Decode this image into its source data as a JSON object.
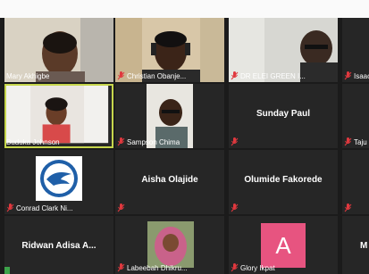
{
  "participants": [
    {
      "name": "Mary Akhigbe"
    },
    {
      "name": "Christian Obanje..."
    },
    {
      "name": "DR ELEI GREEN I..."
    },
    {
      "name": "Isaac"
    },
    {
      "name": "Buduka Johnson"
    },
    {
      "name": "Sampson Chima"
    },
    {
      "name": "Sunday Paul"
    },
    {
      "name": "Taju"
    },
    {
      "name": "Conrad Clark Ni..."
    },
    {
      "name": "Aisha Olajide"
    },
    {
      "name": "Olumide Fakorede"
    },
    {
      "name": ""
    },
    {
      "name": "Ridwan Adisa A..."
    },
    {
      "name": "Labeebah Dhikru..."
    },
    {
      "name": "Glory Ikpat"
    },
    {
      "name": "M"
    }
  ],
  "avatar_letter": "A",
  "colors": {
    "active_border": "#c6d64c",
    "mic_muted": "#e0383e",
    "avatar_pink": "#e75480",
    "logo_blue": "#1f5fa8"
  }
}
